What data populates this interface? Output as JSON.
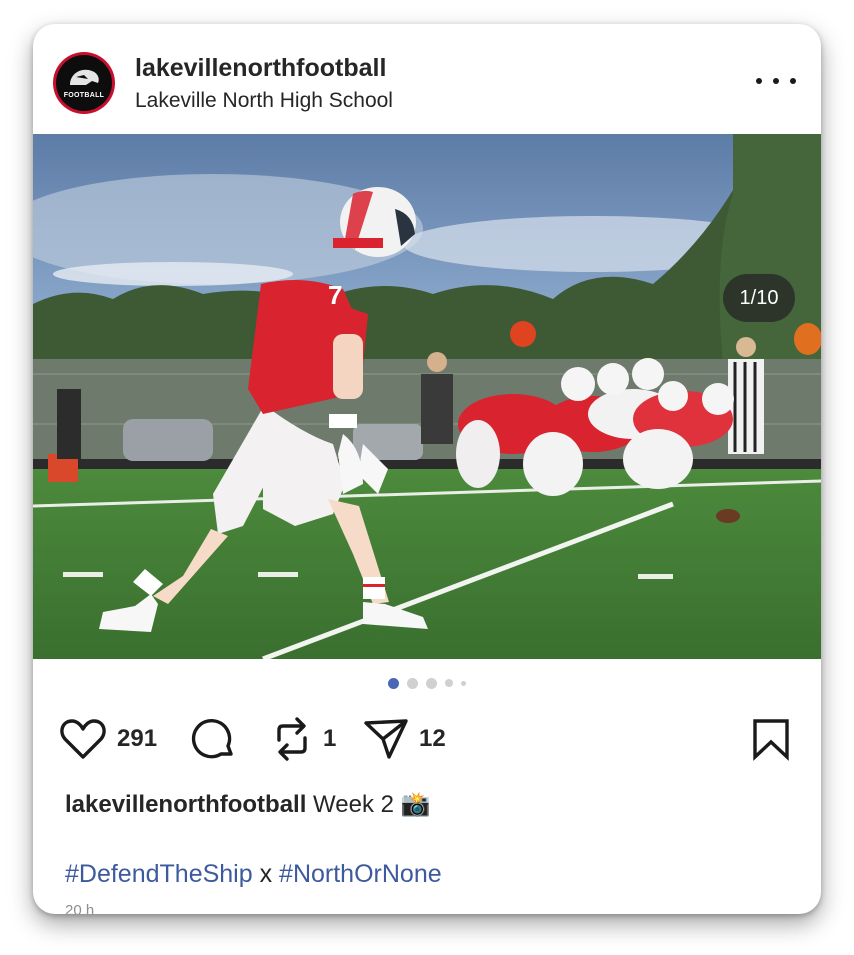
{
  "post": {
    "username": "lakevillenorthfootball",
    "location": "Lakeville North High School",
    "avatar_text": "FOOTBALL",
    "image_counter": "1/10",
    "carousel_dots": 5,
    "active_dot": 1,
    "actions": {
      "likes": "291",
      "reposts": "1",
      "shares": "12"
    },
    "caption_user": "lakevillenorthfootball",
    "caption_text": "Week 2 📸",
    "hashtag_1": "#DefendTheShip",
    "hashtag_sep": "x",
    "hashtag_2": "#NorthOrNone",
    "time_ago": "20 h"
  },
  "colors": {
    "accent": "#3d5a9e",
    "dot_active": "#4a67b5",
    "jersey_red": "#d9232f",
    "field_green": "#3f7a32",
    "sky": "#6f8fb5"
  },
  "icons": [
    "more-icon",
    "heart-icon",
    "comment-icon",
    "repost-icon",
    "share-icon",
    "bookmark-icon"
  ]
}
